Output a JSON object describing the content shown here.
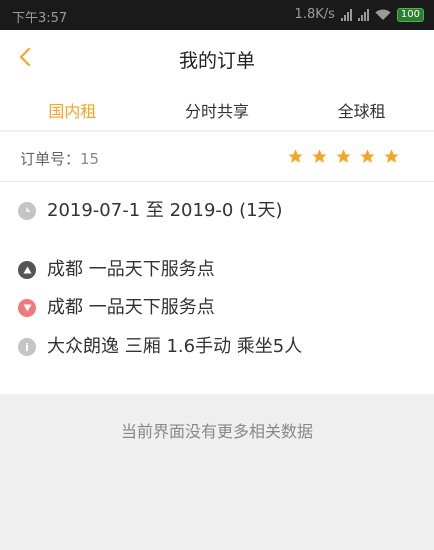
{
  "status_bar": {
    "time": "下午3:57",
    "network_speed": "1.8K/s",
    "battery": "100"
  },
  "nav": {
    "title": "我的订单"
  },
  "tabs": [
    {
      "label": "国内租",
      "active": true
    },
    {
      "label": "分时共享",
      "active": false
    },
    {
      "label": "全球租",
      "active": false
    }
  ],
  "order": {
    "number_label": "订单号：",
    "number_value": "15",
    "rating": 5,
    "time_range": "2019-07-1 至 2019-0 (1天)",
    "pickup_location": "成都 一品天下服务点",
    "return_location": "成都 一品天下服务点",
    "car_info": "大众朗逸  三厢  1.6手动  乘坐5人"
  },
  "footer": {
    "no_more_text": "当前界面没有更多相关数据"
  },
  "colors": {
    "accent": "#f5a623",
    "star": "#f5a623",
    "return_marker": "#f07a7a"
  }
}
